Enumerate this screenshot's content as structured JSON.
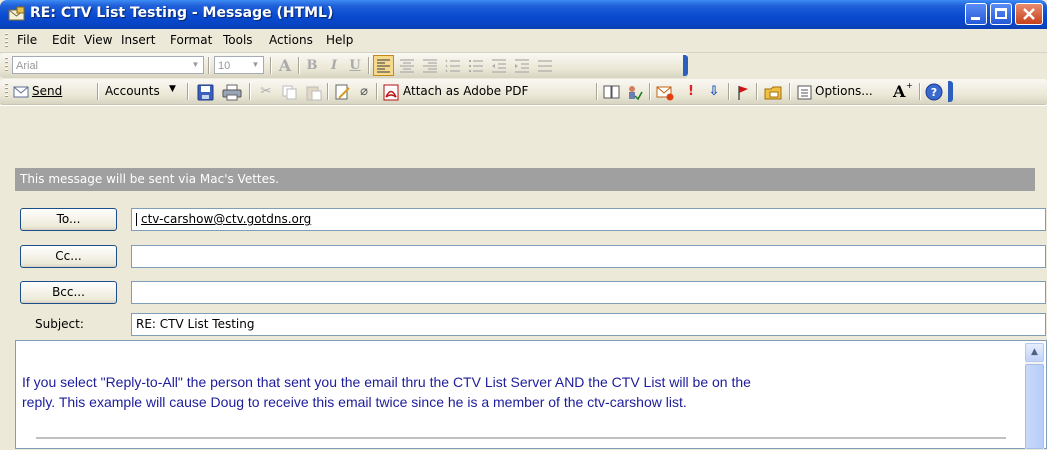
{
  "window": {
    "title": "RE: CTV List Testing - Message (HTML)",
    "icon": "envelope-icon"
  },
  "menu": {
    "items": [
      {
        "label": "File",
        "accel": "F"
      },
      {
        "label": "Edit",
        "accel": "E"
      },
      {
        "label": "View",
        "accel": "V"
      },
      {
        "label": "Insert",
        "accel": "I"
      },
      {
        "label": "Format",
        "accel": "o"
      },
      {
        "label": "Tools",
        "accel": "T"
      },
      {
        "label": "Actions",
        "accel": "A"
      },
      {
        "label": "Help",
        "accel": "H"
      }
    ]
  },
  "format_toolbar": {
    "font": "Arial",
    "size": "10",
    "bold": "B",
    "italic": "I",
    "underline": "U"
  },
  "standard_toolbar": {
    "send": "Send",
    "accounts": "Accounts",
    "attach_pdf": "Attach as Adobe PDF",
    "options": "Options...",
    "font_grow": "A"
  },
  "info_bar": "This message will be sent via Mac's Vettes.",
  "header": {
    "to_button": "To...",
    "cc_button": "Cc...",
    "bcc_button": "Bcc...",
    "to_value": "ctv-carshow@ctv.gotdns.org",
    "cc_value": "",
    "bcc_value": "",
    "subject_label": "Subject:",
    "subject_value": "RE: CTV List Testing"
  },
  "body": {
    "line1": "If you select \"Reply-to-All\" the person that sent you the email thru the CTV List Server AND the CTV List will be on the",
    "line2": "reply.  This example will cause Doug to receive this email twice since he is a member of the ctv-carshow list."
  },
  "colors": {
    "title_bar": "#0a4bd1",
    "body_text": "#1d1d9b",
    "info_bar": "#a0a0a0"
  }
}
